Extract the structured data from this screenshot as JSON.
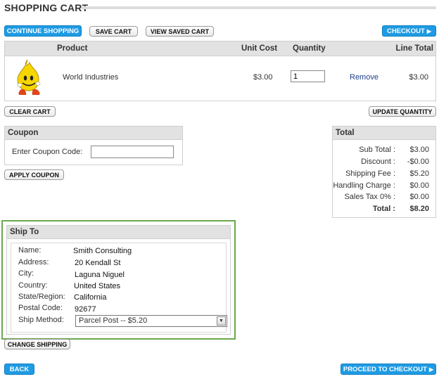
{
  "page": {
    "title": "SHOPPING CART"
  },
  "top_actions": {
    "continue_shopping": "CONTINUE SHOPPING",
    "save_cart": "SAVE CART",
    "view_saved_cart": "VIEW SAVED CART",
    "checkout": "CHECKOUT"
  },
  "cart": {
    "headers": {
      "product": "Product",
      "unit_cost": "Unit Cost",
      "quantity": "Quantity",
      "line_total": "Line Total"
    },
    "items": [
      {
        "name": "World Industries",
        "unit_cost": "$3.00",
        "quantity": "1",
        "remove": "Remove",
        "line_total": "$3.00"
      }
    ],
    "clear_cart": "CLEAR CART",
    "update_quantity": "UPDATE QUANTITY"
  },
  "coupon": {
    "title": "Coupon",
    "label": "Enter Coupon Code:",
    "value": "",
    "apply": "APPLY COUPON"
  },
  "totals": {
    "title": "Total",
    "rows": [
      {
        "label": "Sub Total :",
        "value": "$3.00"
      },
      {
        "label": "Discount :",
        "value": "-$0.00"
      },
      {
        "label": "Shipping Fee :",
        "value": "$5.20"
      },
      {
        "label": "Handling Charge :",
        "value": "$0.00"
      },
      {
        "label": "Sales Tax 0% :",
        "value": "$0.00"
      },
      {
        "label": "Total :",
        "value": "$8.20"
      }
    ]
  },
  "ship_to": {
    "title": "Ship To",
    "fields": [
      {
        "label": "Name:",
        "value": "Smith Consulting"
      },
      {
        "label": "Address:",
        "value": "20 Kendall St"
      },
      {
        "label": "City:",
        "value": "Laguna Niguel"
      },
      {
        "label": "Country:",
        "value": "United States"
      },
      {
        "label": "State/Region:",
        "value": "California"
      },
      {
        "label": "Postal Code:",
        "value": "92677"
      }
    ],
    "ship_method_label": "Ship Method:",
    "ship_method_value": "Parcel Post -- $5.20",
    "change_shipping": "CHANGE SHIPPING"
  },
  "bottom_actions": {
    "back": "BACK",
    "proceed": "PROCEED TO CHECKOUT"
  },
  "colors": {
    "accent_blue": "#1e9be3",
    "highlight_green": "#6aa84f"
  }
}
